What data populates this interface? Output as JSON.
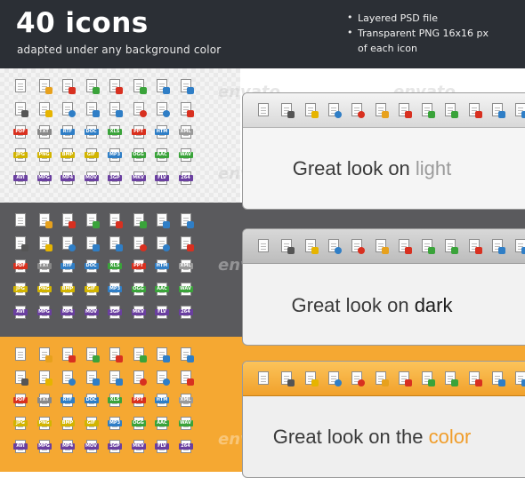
{
  "header": {
    "title": "40 icons",
    "subtitle": "adapted under any background color",
    "features": [
      {
        "bullet": "•",
        "text": "Layered PSD file"
      },
      {
        "bullet": "•",
        "text": "Transparent PNG 16x16 px"
      },
      {
        "bullet": "",
        "text": "of each icon"
      }
    ]
  },
  "watermark": "envato",
  "icon_rows": [
    [
      "document-icon",
      "edit-icon",
      "delete-icon",
      "add-icon",
      "remove-icon",
      "export-icon",
      "download-icon",
      "upload-icon"
    ],
    [
      "save-icon",
      "lock-icon",
      "search-icon",
      "back-icon",
      "forward-icon",
      "block-icon",
      "info-icon",
      "bookmark-icon"
    ],
    [
      "PDF",
      "TXT",
      "RTF",
      "DOC",
      "XLS",
      "PPT",
      "HTM",
      "XML"
    ],
    [
      "JPG",
      "PNG",
      "BMP",
      "GIF",
      "MP3",
      "OGG",
      "AAC",
      "WAV"
    ],
    [
      "AVI",
      "MPG",
      "MP4",
      "MOV",
      "3GP",
      "MKV",
      "FLV",
      "264"
    ]
  ],
  "toolbar_icons": [
    "document-icon",
    "save-icon",
    "lock-icon",
    "info-icon",
    "block-icon",
    "edit-icon",
    "delete-icon",
    "export-icon",
    "add-icon",
    "remove-icon",
    "download-icon",
    "upload-icon"
  ],
  "sections": {
    "light": {
      "prefix": "Great look on ",
      "word": "light"
    },
    "dark": {
      "prefix": "Great look on ",
      "word": "dark"
    },
    "color": {
      "prefix": "Great look on the ",
      "word": "color"
    }
  },
  "colors": {
    "header_bg": "#2b2f35",
    "dark_bg": "#5a5a5d",
    "color_bg": "#f5a832",
    "badge_red": "#d9301e",
    "badge_blue": "#2f7ec6",
    "badge_yellow": "#d2b400",
    "badge_green": "#3aa33a",
    "badge_purple": "#6a3fa0"
  }
}
